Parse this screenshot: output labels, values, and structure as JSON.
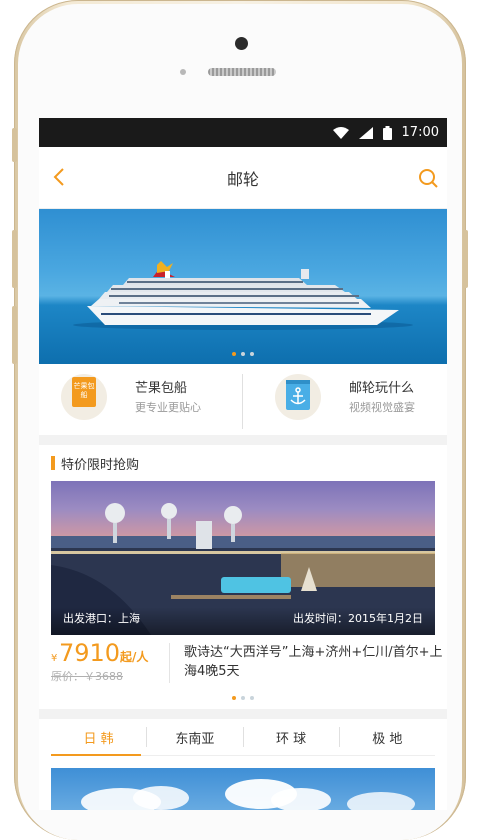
{
  "status_bar": {
    "time": "17:00"
  },
  "nav": {
    "title": "邮轮"
  },
  "banner": {
    "active_dot": 0,
    "dot_count": 3
  },
  "features": [
    {
      "title": "芒果包船",
      "subtitle": "更专业更贴心",
      "icon_label": "芒果包船"
    },
    {
      "title": "邮轮玩什么",
      "subtitle": "视频视觉盛宴"
    }
  ],
  "flash_sale": {
    "title": "特价限时抢购",
    "port_label": "出发港口：上海",
    "date_label": "出发时间：2015年1月2日",
    "currency": "¥",
    "price": "7910",
    "price_unit": "起/人",
    "original_price": "原价：￥3688",
    "deal_title": "歌诗达“大西洋号”上海+济州+仁川/首尔+上海4晚5天"
  },
  "region_tabs": [
    "日 韩",
    "东南亚",
    "环 球",
    "极 地"
  ],
  "colors": {
    "accent": "#f39a1e",
    "statusbar": "#1a1a1a"
  }
}
